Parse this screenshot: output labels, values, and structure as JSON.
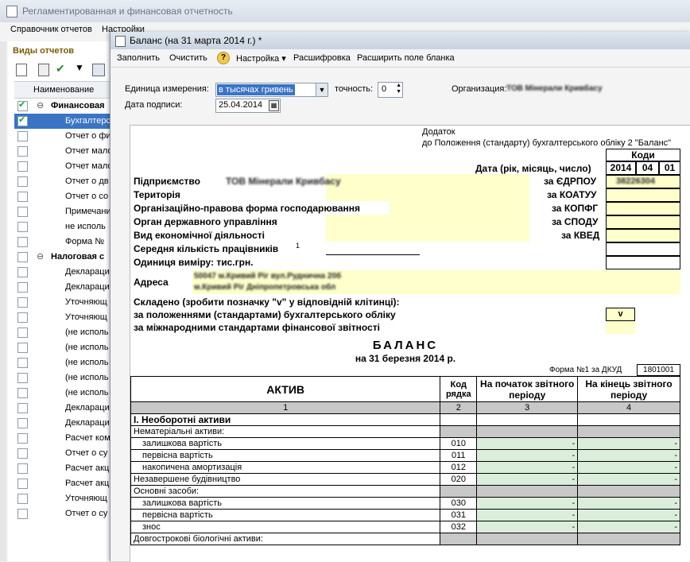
{
  "back_window": {
    "title": "Регламентированная и финансовая отчетность",
    "menu": [
      "Справочник отчетов",
      "Настройки"
    ],
    "panel_title": "Виды отчетов",
    "column_header": "Наименование",
    "rows": [
      {
        "text": "Финансовая",
        "group": true,
        "checked": true
      },
      {
        "text": "Бухгалтерс",
        "checked": true,
        "selected": true
      },
      {
        "text": "Отчет о фи"
      },
      {
        "text": "Отчет мало"
      },
      {
        "text": "Отчет мало"
      },
      {
        "text": "Отчет о дв"
      },
      {
        "text": "Отчет о со"
      },
      {
        "text": "Примечани"
      },
      {
        "text": "не исполь"
      },
      {
        "text": "Форма №"
      },
      {
        "text": "Налоговая с",
        "group": true
      },
      {
        "text": "Декларация"
      },
      {
        "text": "Декларация"
      },
      {
        "text": "Уточняющ"
      },
      {
        "text": "Уточняющ"
      },
      {
        "text": "(не исполь"
      },
      {
        "text": "(не исполь"
      },
      {
        "text": "(не исполь"
      },
      {
        "text": "(не исполь"
      },
      {
        "text": "(не исполь"
      },
      {
        "text": "Декларация"
      },
      {
        "text": "Декларация"
      },
      {
        "text": "Расчет ком"
      },
      {
        "text": "Отчет о су"
      },
      {
        "text": "Расчет акц"
      },
      {
        "text": "Расчет акц"
      },
      {
        "text": "Уточняющ"
      },
      {
        "text": "Отчет о су"
      }
    ]
  },
  "front_window": {
    "title": "Баланс (на 31 марта 2014 г.) *",
    "toolbar": {
      "fill": "Заполнить",
      "clear": "Очистить",
      "settings": "Настройка ▾",
      "decode": "Расшифровка",
      "expand": "Расширить поле бланка"
    },
    "unit_label": "Единица измерения:",
    "unit_value": "в тысячах гривень",
    "precision_label": "точность:",
    "precision_value": "0",
    "org_label": "Организация:",
    "org_value": "ТОВ Мінерали Кривбасу",
    "date_label": "Дата подписи:",
    "date_value": "25.04.2014"
  },
  "form": {
    "annex1": "Додаток",
    "annex2": "до Положення (стандарту) бухгалтерського обліку 2 \"Баланс\"",
    "codes_header": "Коди",
    "date_label": "Дата (рік, місяць, число)",
    "date_year": "2014",
    "date_month": "04",
    "date_day": "01",
    "enterprise": "Підприємство",
    "enterprise_value": "ТОВ Мінерали Кривбасу",
    "territory": "Територія",
    "legal_form": "Організаційно-правова форма господарювання",
    "gov_body": "Орган державного управління",
    "activity": "Вид економічної діяльності",
    "employees": "Середня кількість працівників",
    "employees_sup": "1",
    "unit": "Одиниця виміру: тис.грн.",
    "address": "Адреса",
    "address_line1": "50047 м.Кривий Ріг вул.Руднична 20б",
    "address_line2": "м.Кривий Ріг Дніпропетровська обл",
    "edrpou_label": "за ЄДРПОУ",
    "edrpou_value": "38226304",
    "koatuu_label": "за КОАТУУ",
    "kopfg_label": "за КОПФГ",
    "spodu_label": "за СПОДУ",
    "kved_label": "за КВЕД",
    "compiled": "Складено (зробити позначку \"v\" у відповідній клітинці):",
    "by_national": "за положеннями (стандартами) бухгалтерського обліку",
    "by_international": "за міжнародними стандартами фінансової звітності",
    "mark": "v",
    "heading": "БАЛАНС",
    "subheading": "на 31 березня 2014 р.",
    "form_no_label": "Форма №1 за ДКУД",
    "form_no_value": "1801001",
    "table": {
      "h_active": "АКТИВ",
      "h_code": "Код рядка",
      "h_begin": "На початок звітного періоду",
      "h_end": "На кінець звітного періоду",
      "nums": [
        "1",
        "2",
        "3",
        "4"
      ],
      "section1": "І. Необоротні  активи",
      "rows": [
        {
          "label": "Нематеріальні активи:",
          "code": "",
          "kind": "head"
        },
        {
          "label": "залишкова вартість",
          "code": "010",
          "begin": "-",
          "end": "-",
          "indent": true
        },
        {
          "label": "первісна вартість",
          "code": "011",
          "begin": "-",
          "end": "-",
          "indent": true
        },
        {
          "label": "накопичена амортизація",
          "code": "012",
          "begin": "-",
          "end": "-",
          "indent": true
        },
        {
          "label": "Незавершене будівництво",
          "code": "020",
          "begin": "-",
          "end": "-"
        },
        {
          "label": "Основні засоби:",
          "code": "",
          "kind": "head"
        },
        {
          "label": "залишкова вартість",
          "code": "030",
          "begin": "-",
          "end": "-",
          "indent": true
        },
        {
          "label": "первісна вартість",
          "code": "031",
          "begin": "-",
          "end": "-",
          "indent": true
        },
        {
          "label": "знос",
          "code": "032",
          "begin": "-",
          "end": "-",
          "indent": true
        },
        {
          "label": "Довгострокові біологічні активи:",
          "code": "",
          "kind": "head"
        }
      ]
    }
  }
}
